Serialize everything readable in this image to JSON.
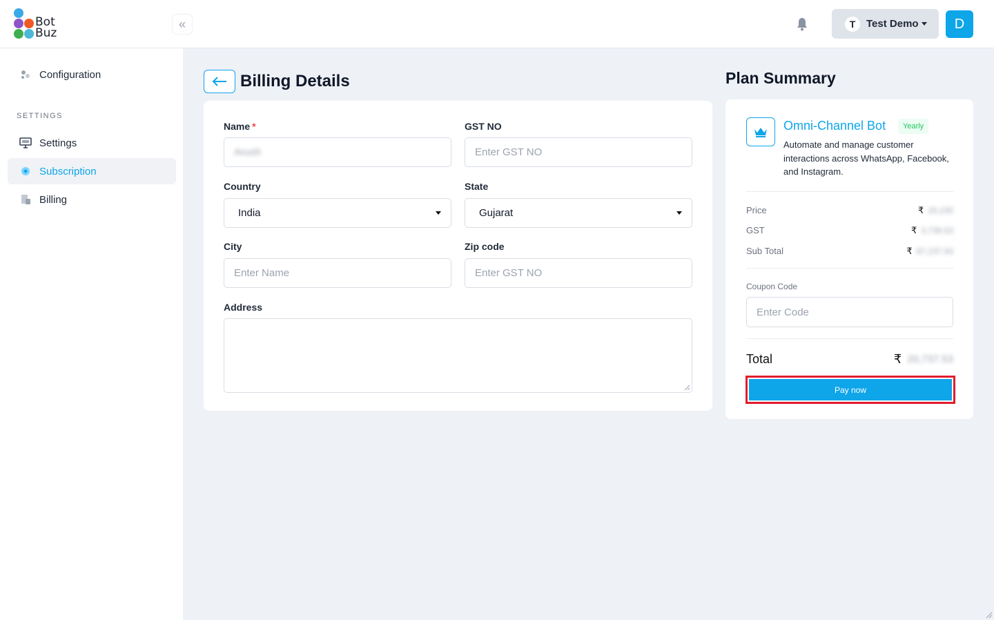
{
  "brand": {
    "line1": "Bot",
    "line2": "Buz"
  },
  "header": {
    "collapse_icon": "chevrons-left-icon",
    "user_initial": "T",
    "user_name": "Test Demo",
    "avatar_letter": "D"
  },
  "sidebar": {
    "items": [
      {
        "label": "Configuration",
        "icon": "configuration-icon"
      },
      {
        "label": "Settings",
        "icon": "monitor-icon"
      },
      {
        "label": "Subscription",
        "icon": "subscription-icon",
        "active": true
      },
      {
        "label": "Billing",
        "icon": "billing-icon"
      }
    ],
    "section_heading": "SETTINGS"
  },
  "billing": {
    "title": "Billing Details",
    "name_label": "Name",
    "name_required": "*",
    "name_value": "Arush",
    "gst_label": "GST NO",
    "gst_placeholder": "Enter GST NO",
    "country_label": "Country",
    "country_value": "India",
    "state_label": "State",
    "state_value": "Gujarat",
    "city_label": "City",
    "city_placeholder": "Enter Name",
    "zip_label": "Zip code",
    "zip_placeholder": "Enter GST NO",
    "address_label": "Address",
    "address_value": ""
  },
  "plan": {
    "title": "Plan Summary",
    "name": "Omni-Channel Bot",
    "badge": "Yearly",
    "description": "Automate and manage customer interactions across WhatsApp, Facebook, and Instagram.",
    "currency": "₹",
    "price_label": "Price",
    "price_value": "20,230",
    "gst_label": "GST",
    "gst_value": "3,739.53",
    "subtotal_label": "Sub Total",
    "subtotal_value": "87,237.93",
    "coupon_label": "Coupon Code",
    "coupon_placeholder": "Enter Code",
    "total_label": "Total",
    "total_value": "20,737.53",
    "pay_label": "Pay now"
  },
  "colors": {
    "accent": "#0ea5e9",
    "highlight": "#e11d2e",
    "badge_text": "#22c55e"
  }
}
